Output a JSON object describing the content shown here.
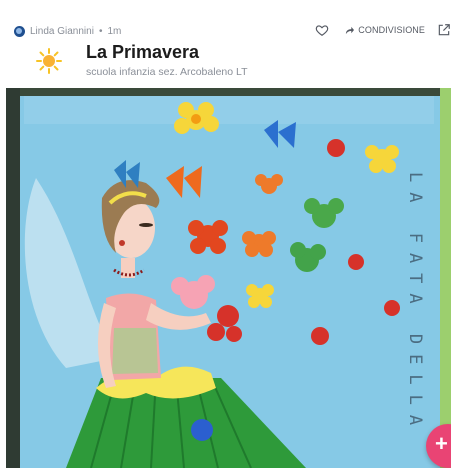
{
  "post": {
    "author": "Linda Giannini",
    "separator": "•",
    "time": "1m",
    "title": "La Primavera",
    "subtitle": "scuola infanzia sez. Arcobaleno LT"
  },
  "actions": {
    "share_label": "CONDIVISIONE"
  },
  "photo": {
    "handwritten_text": "LA FATA DELLA"
  },
  "fab": {
    "label": "+",
    "color": "#e94474"
  },
  "icons": [
    "avatar",
    "heart-icon",
    "share-arrow-icon",
    "open-external-icon",
    "sun-icon",
    "plus-icon"
  ]
}
